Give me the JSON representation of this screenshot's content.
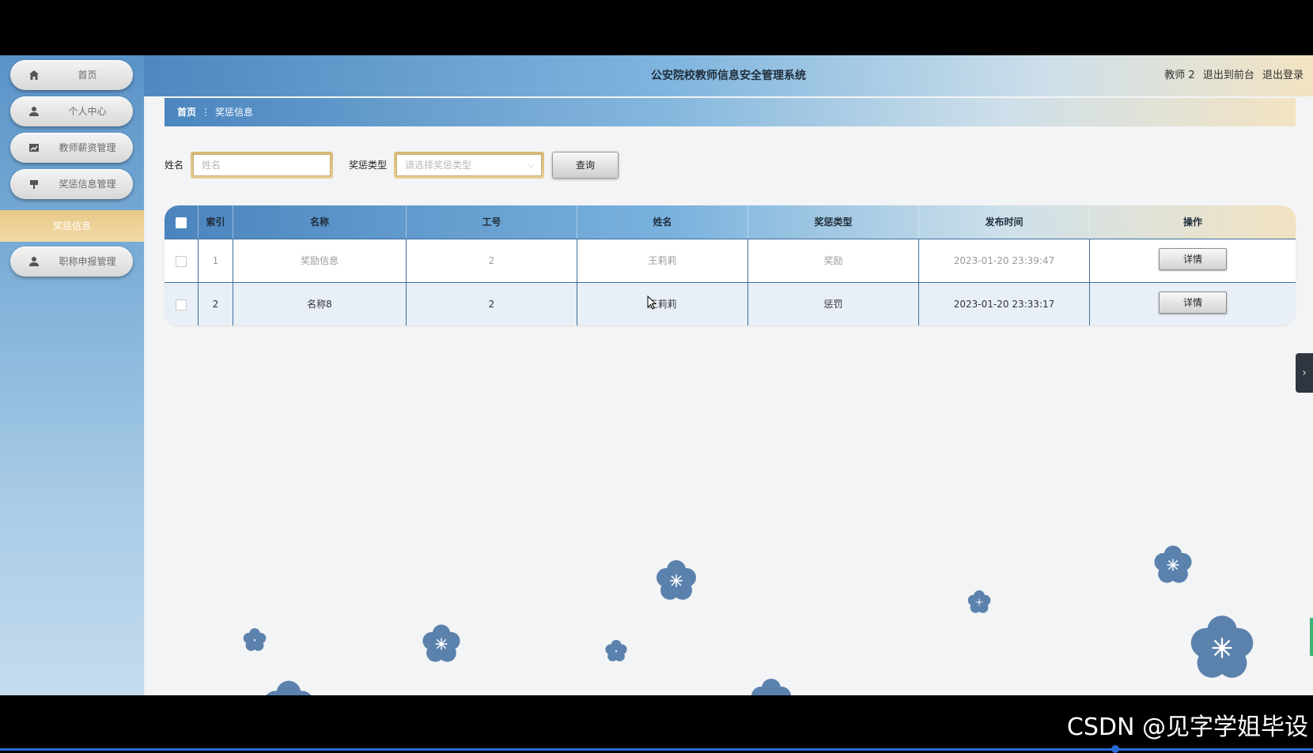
{
  "app": {
    "title": "公安院校教师信息安全管理系统"
  },
  "header": {
    "user": "教师 2",
    "front_link": "退出到前台",
    "logout_link": "退出登录"
  },
  "sidebar": {
    "items": [
      {
        "label": "首页",
        "icon": "home-icon"
      },
      {
        "label": "个人中心",
        "icon": "user-icon"
      },
      {
        "label": "教师薪资管理",
        "icon": "chart-icon"
      },
      {
        "label": "奖惩信息管理",
        "icon": "flag-icon"
      },
      {
        "label": "职称申报管理",
        "icon": "user-icon"
      }
    ],
    "submenu": "奖惩信息"
  },
  "breadcrumb": {
    "home": "首页",
    "separator": "⋮",
    "current": "奖惩信息"
  },
  "search": {
    "name_label": "姓名",
    "name_placeholder": "姓名",
    "type_label": "奖惩类型",
    "type_placeholder": "请选择奖惩类型",
    "query_button": "查询"
  },
  "table": {
    "columns": [
      "索引",
      "名称",
      "工号",
      "姓名",
      "奖惩类型",
      "发布时间",
      "操作"
    ],
    "rows": [
      {
        "index": "1",
        "name": "奖励信息",
        "job_no": "2",
        "person": "王莉莉",
        "type": "奖励",
        "time": "2023-01-20 23:39:47",
        "action": "详情"
      },
      {
        "index": "2",
        "name": "名称8",
        "job_no": "2",
        "person": "王莉莉",
        "type": "惩罚",
        "time": "2023-01-20 23:33:17",
        "action": "详情"
      }
    ]
  },
  "watermark": "CSDN @见字学姐毕设",
  "colors": {
    "accent_blue": "#4f88bf",
    "accent_gold": "#e9c98a",
    "flower": "#5b82ad"
  }
}
